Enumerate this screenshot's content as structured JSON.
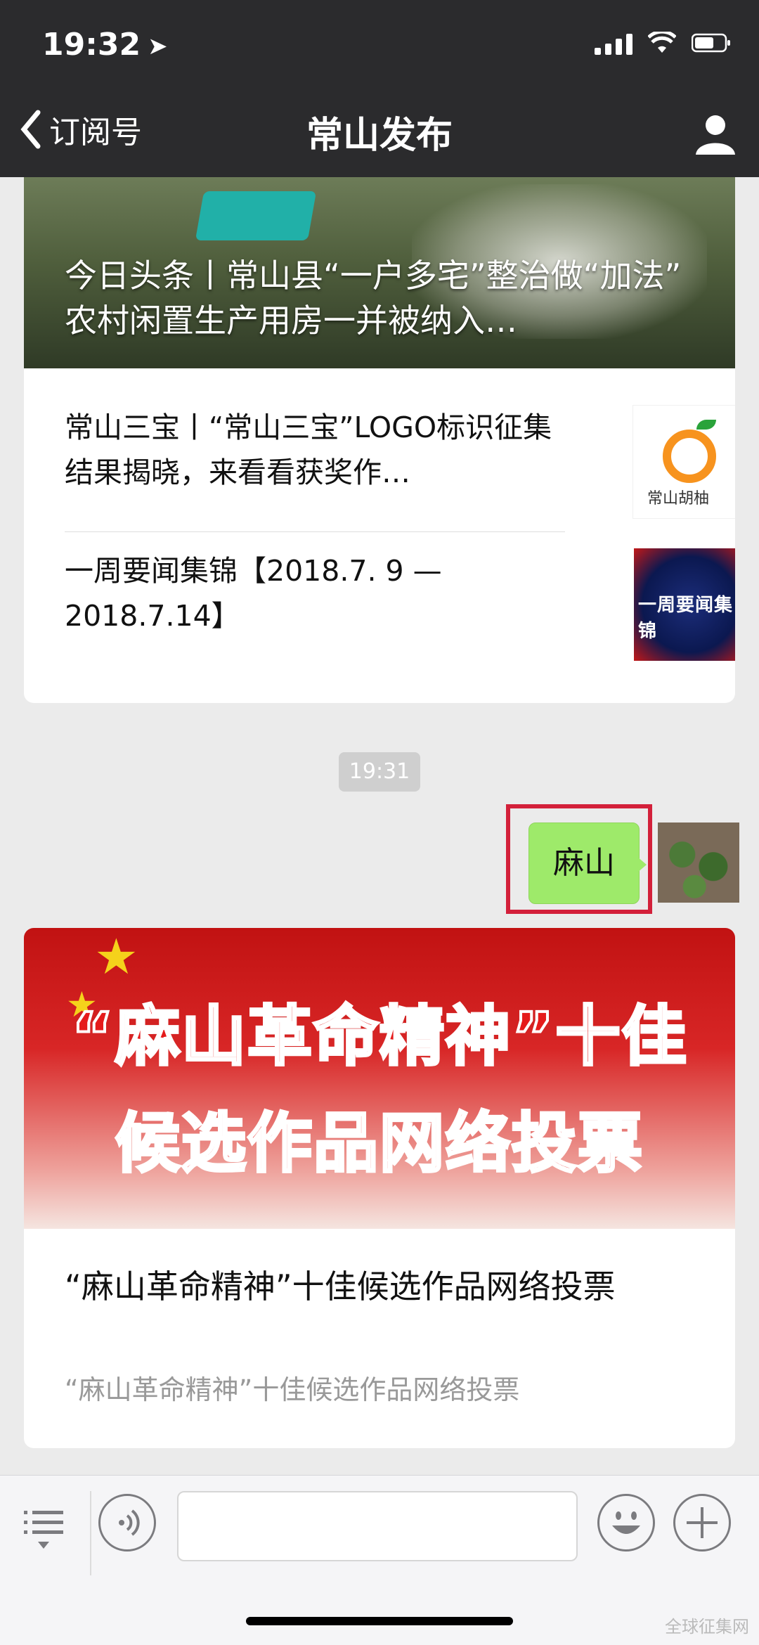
{
  "status_bar": {
    "time": "19:32"
  },
  "nav": {
    "back_label": "订阅号",
    "title": "常山发布"
  },
  "top_card": {
    "headline": "今日头条丨常山县“一户多宅”整治做“加法” 农村闲置生产用房一并被纳入…",
    "items": [
      {
        "title": "常山三宝丨“常山三宝”LOGO标识征集结果揭晓，来看看获奖作…",
        "thumb_text": "常山胡柚"
      },
      {
        "title": "一周要闻集锦【2018.7. 9 — 2018.7.14】",
        "thumb_text": "一周要闻集锦"
      }
    ]
  },
  "timestamp": "19:31",
  "message": {
    "text": "麻山"
  },
  "vote_card": {
    "banner_line1": "“麻山革命精神”十佳",
    "banner_line2": "候选作品网络投票",
    "title": "“麻山革命精神”十佳候选作品网络投票",
    "desc": "“麻山革命精神”十佳候选作品网络投票"
  },
  "watermark": "全球征集网",
  "colors": {
    "nav_bg": "#2b2b2d",
    "bubble_green": "#9eea6a",
    "highlight_red": "#d3203a"
  },
  "icons": [
    "location-arrow-icon",
    "signal-icon",
    "wifi-icon",
    "battery-icon",
    "back-chevron-icon",
    "profile-icon",
    "menu-icon",
    "voice-icon",
    "emoji-icon",
    "plus-icon"
  ]
}
